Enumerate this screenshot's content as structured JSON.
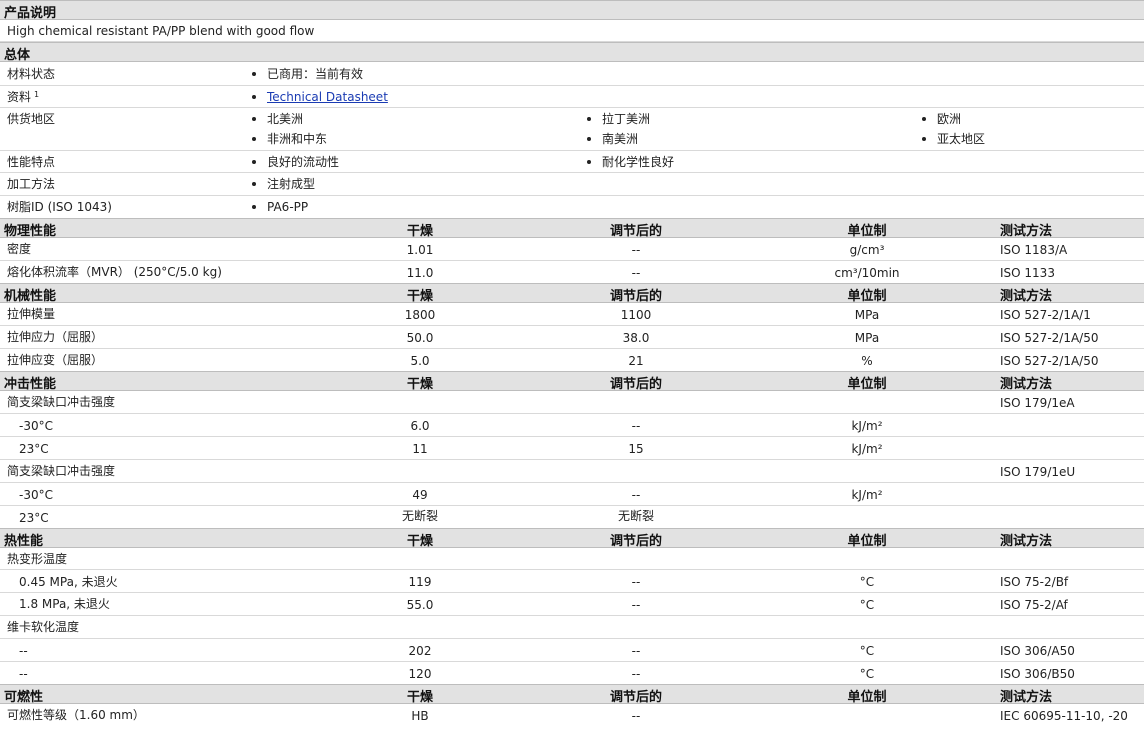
{
  "product_description": {
    "header": "产品说明",
    "text": "High chemical resistant PA/PP blend with good flow"
  },
  "general": {
    "header": "总体",
    "material_status": {
      "label": "材料状态",
      "value": "已商用：当前有效"
    },
    "documents": {
      "label": "资料",
      "footnote": "1",
      "link": "Technical Datasheet"
    },
    "availability": {
      "label": "供货地区",
      "regions": [
        "北美洲",
        "拉丁美洲",
        "欧洲",
        "非洲和中东",
        "南美洲",
        "亚太地区"
      ]
    },
    "features": {
      "label": "性能特点",
      "items": [
        "良好的流动性",
        "耐化学性良好"
      ]
    },
    "processing": {
      "label": "加工方法",
      "value": "注射成型"
    },
    "resin_id": {
      "label": "树脂ID (ISO 1043)",
      "value": "PA6-PP"
    }
  },
  "columns": {
    "dry": "干燥",
    "conditioned": "调节后的",
    "unit": "单位制",
    "method": "测试方法"
  },
  "physical": {
    "header": "物理性能",
    "rows": [
      {
        "label": "密度",
        "dry": "1.01",
        "cond": "--",
        "unit": "g/cm³",
        "method": "ISO 1183/A"
      },
      {
        "label": "熔化体积流率（MVR） (250°C/5.0 kg)",
        "dry": "11.0",
        "cond": "--",
        "unit": "cm³/10min",
        "method": "ISO 1133"
      }
    ]
  },
  "mechanical": {
    "header": "机械性能",
    "rows": [
      {
        "label": "拉伸模量",
        "dry": "1800",
        "cond": "1100",
        "unit": "MPa",
        "method": "ISO 527-2/1A/1"
      },
      {
        "label": "拉伸应力（屈服）",
        "dry": "50.0",
        "cond": "38.0",
        "unit": "MPa",
        "method": "ISO 527-2/1A/50"
      },
      {
        "label": "拉伸应变（屈服）",
        "dry": "5.0",
        "cond": "21",
        "unit": "%",
        "method": "ISO 527-2/1A/50"
      }
    ]
  },
  "impact": {
    "header": "冲击性能",
    "group1": {
      "label": "简支梁缺口冲击强度",
      "method": "ISO 179/1eA"
    },
    "g1rows": [
      {
        "label": "-30°C",
        "dry": "6.0",
        "cond": "--",
        "unit": "kJ/m²"
      },
      {
        "label": "23°C",
        "dry": "11",
        "cond": "15",
        "unit": "kJ/m²"
      }
    ],
    "group2": {
      "label": "简支梁缺口冲击强度",
      "method": "ISO 179/1eU"
    },
    "g2rows": [
      {
        "label": "-30°C",
        "dry": "49",
        "cond": "--",
        "unit": "kJ/m²"
      },
      {
        "label": "23°C",
        "dry": "无断裂",
        "cond": "无断裂",
        "unit": ""
      }
    ]
  },
  "thermal": {
    "header": "热性能",
    "group1": {
      "label": "热变形温度"
    },
    "g1rows": [
      {
        "label": "0.45 MPa, 未退火",
        "dry": "119",
        "cond": "--",
        "unit": "°C",
        "method": "ISO 75-2/Bf"
      },
      {
        "label": "1.8 MPa, 未退火",
        "dry": "55.0",
        "cond": "--",
        "unit": "°C",
        "method": "ISO 75-2/Af"
      }
    ],
    "group2": {
      "label": "维卡软化温度"
    },
    "g2rows": [
      {
        "label": "--",
        "dry": "202",
        "cond": "--",
        "unit": "°C",
        "method": "ISO 306/A50"
      },
      {
        "label": "--",
        "dry": "120",
        "cond": "--",
        "unit": "°C",
        "method": "ISO 306/B50"
      }
    ]
  },
  "flammability": {
    "header": "可燃性",
    "rows": [
      {
        "label": "可燃性等级（1.60 mm）",
        "dry": "HB",
        "cond": "--",
        "unit": "",
        "method": "IEC 60695-11-10, -20"
      }
    ]
  }
}
